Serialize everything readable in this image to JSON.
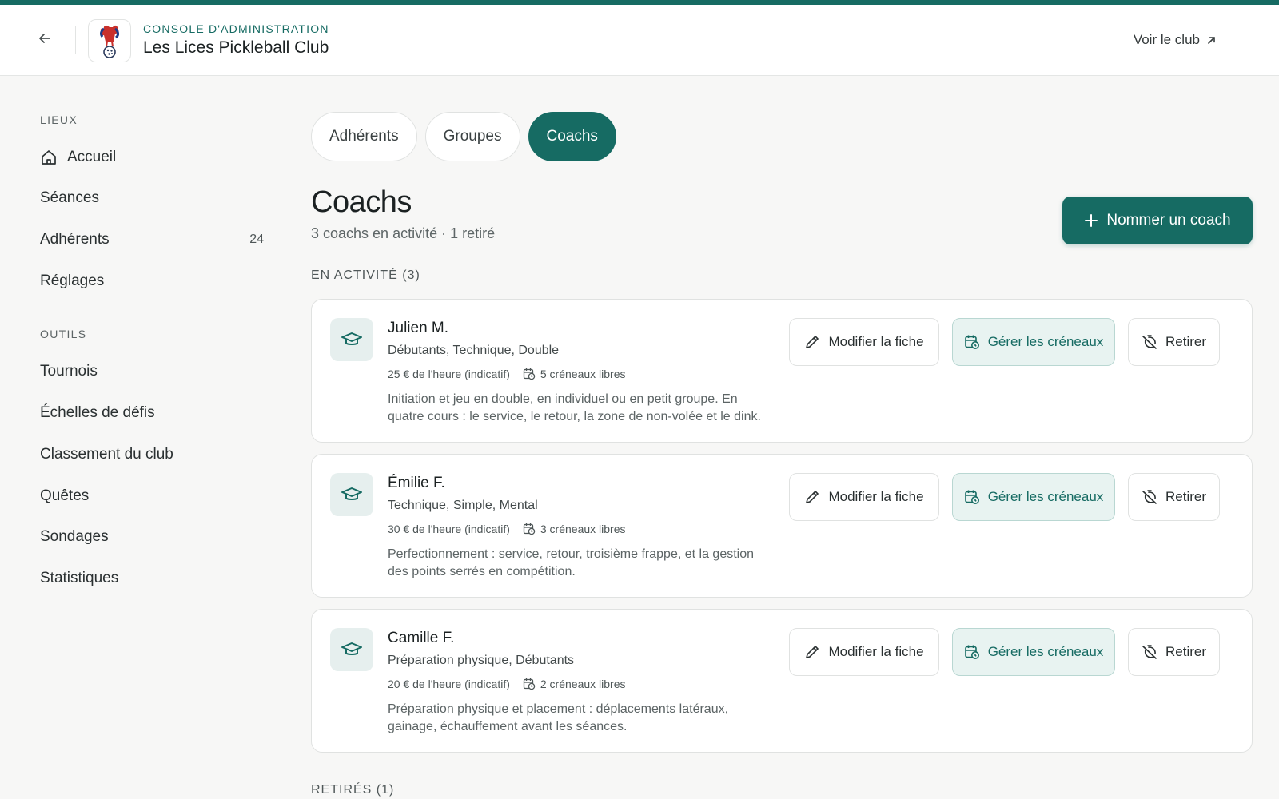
{
  "header": {
    "kicker": "CONSOLE D'ADMINISTRATION",
    "title": "Les Lices Pickleball Club",
    "view_club": "Voir le club"
  },
  "sidebar": {
    "section_places": "LIEUX",
    "items_places": [
      {
        "label": "Accueil",
        "icon": "home-icon"
      },
      {
        "label": "Séances"
      },
      {
        "label": "Adhérents",
        "count": "24"
      },
      {
        "label": "Réglages"
      }
    ],
    "section_tools": "OUTILS",
    "items_tools": [
      {
        "label": "Tournois"
      },
      {
        "label": "Échelles de défis"
      },
      {
        "label": "Classement du club"
      },
      {
        "label": "Quêtes"
      },
      {
        "label": "Sondages"
      },
      {
        "label": "Statistiques"
      }
    ]
  },
  "tabs": [
    {
      "label": "Adhérents"
    },
    {
      "label": "Groupes"
    },
    {
      "label": "Coachs",
      "active": true
    }
  ],
  "page": {
    "title": "Coachs",
    "subtitle": "3 coachs en activité · 1 retiré",
    "primary_button": "Nommer un coach",
    "section_active": "EN ACTIVITÉ (3)",
    "section_retired": "RETIRÉS (1)"
  },
  "coaches": [
    {
      "name": "Julien M.",
      "tags": "Débutants, Technique, Double",
      "rate": "25 € de l'heure (indicatif)",
      "slots": "5 créneaux libres",
      "description": "Initiation et jeu en double, en individuel ou en petit groupe. En quatre cours : le service, le retour, la zone de non-volée et le dink."
    },
    {
      "name": "Émilie F.",
      "tags": "Technique, Simple, Mental",
      "rate": "30 € de l'heure (indicatif)",
      "slots": "3 créneaux libres",
      "description": "Perfectionnement : service, retour, troisième frappe, et la gestion des points serrés en compétition."
    },
    {
      "name": "Camille F.",
      "tags": "Préparation physique, Débutants",
      "rate": "20 € de l'heure (indicatif)",
      "slots": "2 créneaux libres",
      "description": "Préparation physique et placement : déplacements latéraux, gainage, échauffement avant les séances."
    }
  ],
  "card_actions": {
    "edit": "Modifier la fiche",
    "slots": "Gérer les créneaux",
    "retire": "Retirer"
  },
  "colors": {
    "accent": "#166b63",
    "accent_light": "#e8f3f1"
  }
}
